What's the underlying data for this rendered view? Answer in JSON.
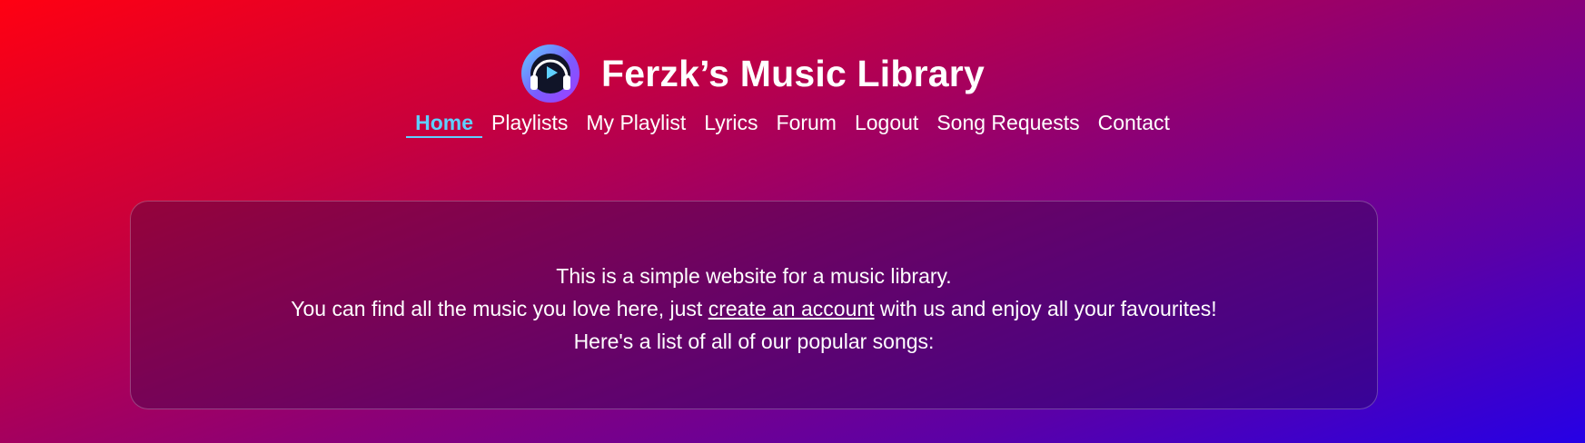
{
  "header": {
    "site_title": "Ferzk’s Music Library",
    "logo_icon": "headphones-play-icon"
  },
  "nav": {
    "items": [
      {
        "label": "Home",
        "active": true
      },
      {
        "label": "Playlists",
        "active": false
      },
      {
        "label": "My Playlist",
        "active": false
      },
      {
        "label": "Lyrics",
        "active": false
      },
      {
        "label": "Forum",
        "active": false
      },
      {
        "label": "Logout",
        "active": false
      },
      {
        "label": "Song Requests",
        "active": false
      },
      {
        "label": "Contact",
        "active": false
      }
    ]
  },
  "intro": {
    "line1": "This is a simple website for a music library.",
    "line2_before": "You can find all the music you love here, just ",
    "line2_link": "create an account",
    "line2_after": " with us and enjoy all your favourites!",
    "line3": "Here's a list of all of our popular songs:"
  },
  "colors": {
    "accent": "#5fd0ff",
    "background_start": "#ff0012",
    "background_end": "#2600e6"
  }
}
